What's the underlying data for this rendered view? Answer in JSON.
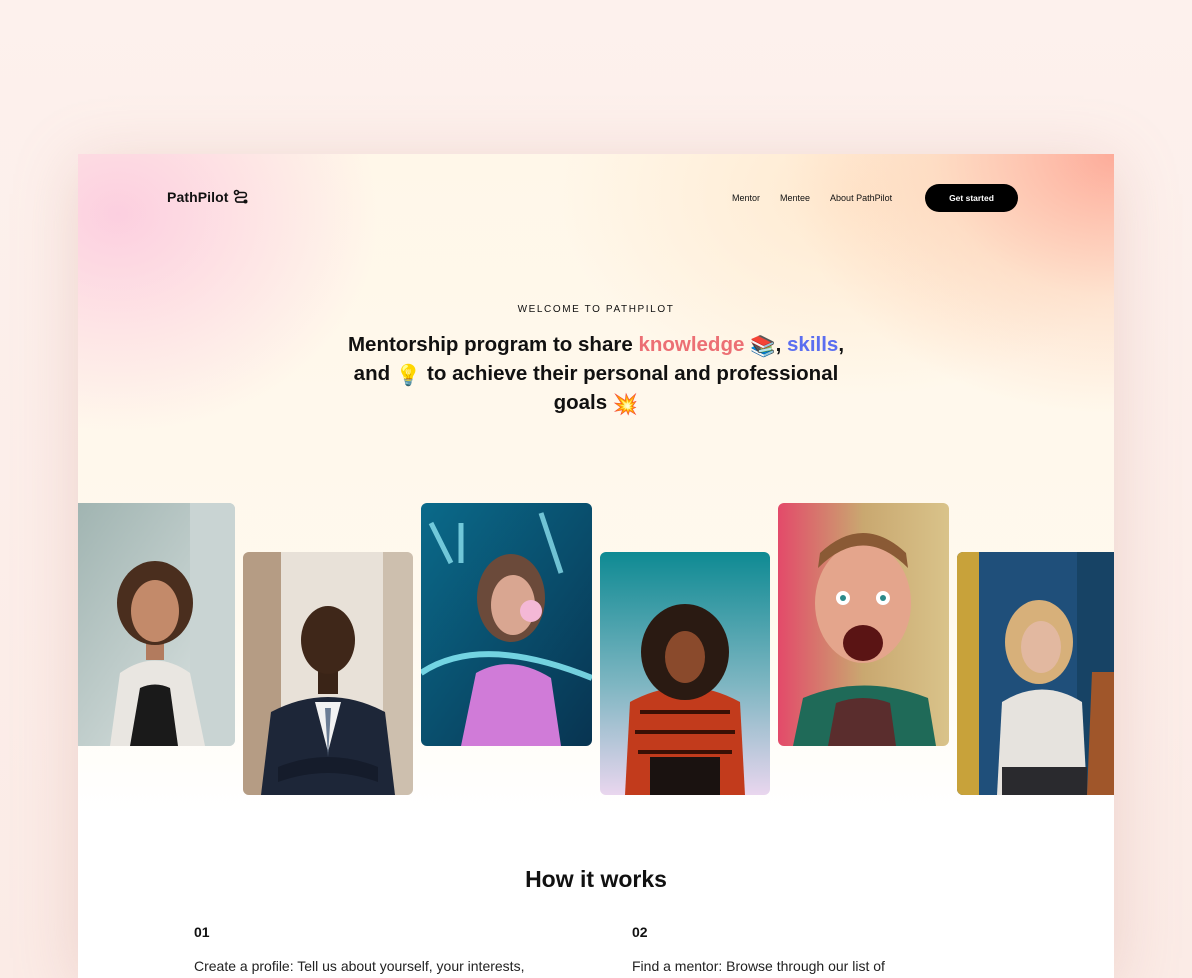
{
  "brand": {
    "name": "PathPilot",
    "logo_icon": "route-icon"
  },
  "nav": {
    "items": [
      "Mentor",
      "Mentee",
      "About PathPilot"
    ],
    "cta_label": "Get started"
  },
  "hero": {
    "eyebrow": "WELCOME TO PATHPILOT",
    "headline": {
      "part1": "Mentorship program to share ",
      "knowledge": "knowledge",
      "emoji_books": "📚",
      "comma1": ",",
      "skills": "skills",
      "part2": ", and ",
      "emoji_bulb": "💡",
      "part3": " to achieve their personal and professional goals ",
      "emoji_collision": "💥"
    },
    "accent_pink": "#ec6f74",
    "accent_blue": "#5b6ef0"
  },
  "gallery": {
    "photos": [
      {
        "description_name": "mentor-photo-woman-curly-hair"
      },
      {
        "description_name": "mentor-photo-man-suit"
      },
      {
        "description_name": "mentee-photo-neon-bubblegum"
      },
      {
        "description_name": "mentee-photo-red-sweater"
      },
      {
        "description_name": "mentee-photo-surprised-man"
      },
      {
        "description_name": "mentee-photo-blonde-woman"
      }
    ]
  },
  "how_it_works": {
    "title": "How it works",
    "steps": [
      {
        "number": "01",
        "text": "Create a profile: Tell us about yourself, your interests,"
      },
      {
        "number": "02",
        "text": "Find a mentor: Browse through our list of"
      }
    ]
  }
}
